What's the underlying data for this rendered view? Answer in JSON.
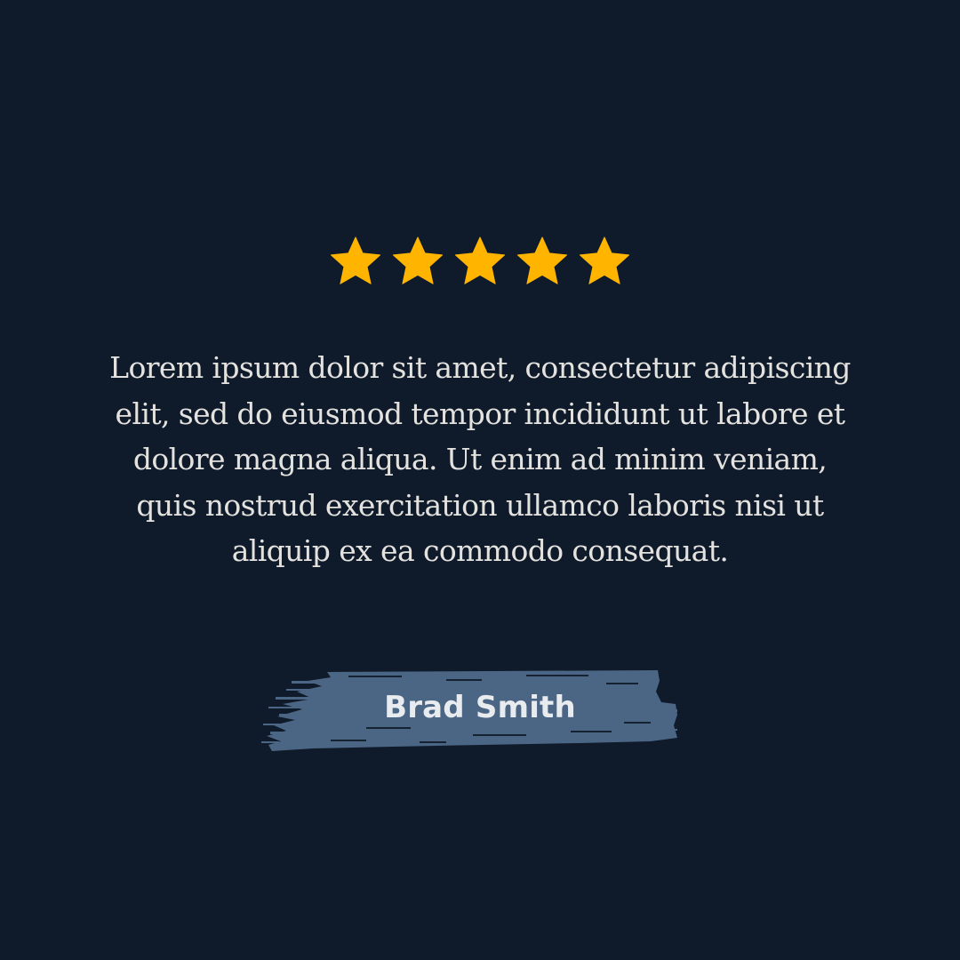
{
  "rating": {
    "stars_filled": 5,
    "stars_total": 5,
    "star_color": "#ffb400",
    "icon": "star-icon"
  },
  "testimonial": {
    "quote": "Lorem ipsum dolor sit amet, consectetur adipiscing elit, sed do eiusmod tempor incididunt ut labore et dolore magna aliqua. Ut enim ad minim veniam, quis nostrud exercitation ullamco laboris nisi ut aliquip ex ea commodo consequat."
  },
  "author": {
    "name": "Brad Smith"
  },
  "colors": {
    "background": "#0f1b2a",
    "text": "#e4e2df",
    "brush": "#4b6584"
  }
}
